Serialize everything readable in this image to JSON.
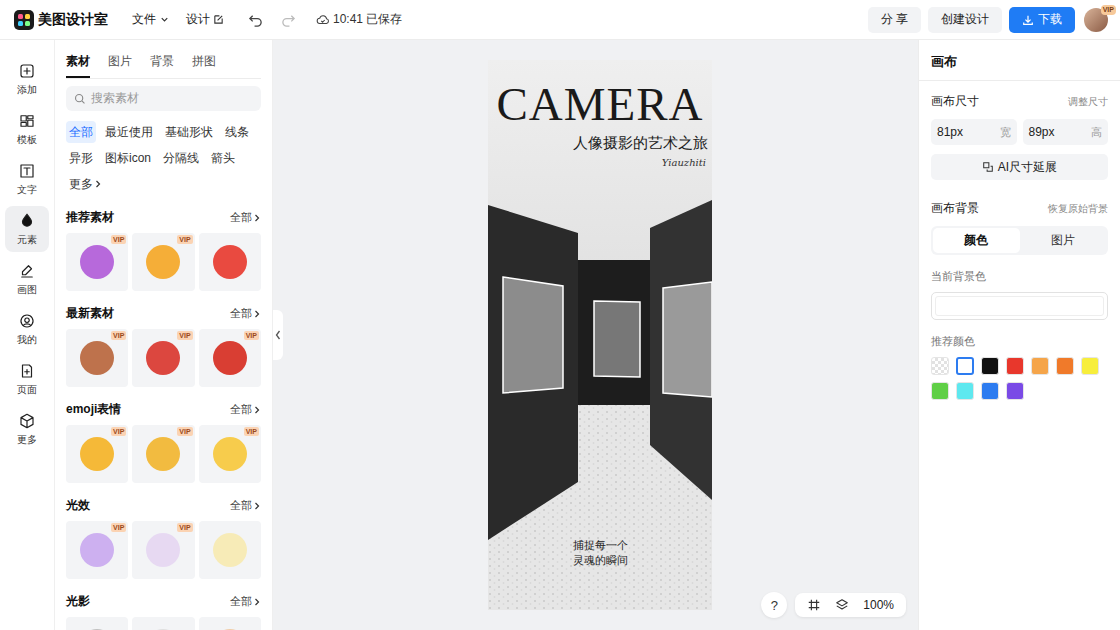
{
  "app": {
    "name": "美图设计室"
  },
  "menus": [
    {
      "label": "文件"
    },
    {
      "label": "设计"
    }
  ],
  "save_status": "10:41 已保存",
  "actions": {
    "share": "分 享",
    "create": "创建设计",
    "download": "下载"
  },
  "avatar": {
    "badge": "VIP"
  },
  "rail": [
    {
      "label": "添加",
      "selected": false
    },
    {
      "label": "模板",
      "selected": false
    },
    {
      "label": "文字",
      "selected": false
    },
    {
      "label": "元素",
      "selected": true
    },
    {
      "label": "画图",
      "selected": false
    },
    {
      "label": "我的",
      "selected": false
    },
    {
      "label": "页面",
      "selected": false
    },
    {
      "label": "更多",
      "selected": false
    }
  ],
  "panel": {
    "tabs": [
      {
        "label": "素材",
        "selected": true
      },
      {
        "label": "图片",
        "selected": false
      },
      {
        "label": "背景",
        "selected": false
      },
      {
        "label": "拼图",
        "selected": false
      }
    ],
    "search": {
      "placeholder": "搜索素材"
    },
    "chips": [
      {
        "label": "全部",
        "selected": true
      },
      {
        "label": "最近使用",
        "selected": false
      },
      {
        "label": "基础形状",
        "selected": false
      },
      {
        "label": "线条",
        "selected": false
      },
      {
        "label": "异形",
        "selected": false
      },
      {
        "label": "图标icon",
        "selected": false
      },
      {
        "label": "分隔线",
        "selected": false
      },
      {
        "label": "箭头",
        "selected": false
      },
      {
        "label": "更多",
        "selected": false
      }
    ],
    "sections": [
      {
        "title": "推荐素材",
        "more": "全部",
        "tiles": [
          {
            "badge": "VIP",
            "color": "#b05ad8"
          },
          {
            "badge": "VIP",
            "color": "#f5a623"
          },
          {
            "badge": "",
            "color": "#e8372c"
          }
        ]
      },
      {
        "title": "最新素材",
        "more": "全部",
        "tiles": [
          {
            "badge": "VIP",
            "color": "#b8643a"
          },
          {
            "badge": "VIP",
            "color": "#d9342b"
          },
          {
            "badge": "VIP",
            "color": "#d62a1e"
          }
        ]
      },
      {
        "title": "emoji表情",
        "more": "全部",
        "tiles": [
          {
            "badge": "VIP",
            "color": "#f5b323"
          },
          {
            "badge": "VIP",
            "color": "#f2b52c"
          },
          {
            "badge": "VIP",
            "color": "#f7c83a"
          }
        ]
      },
      {
        "title": "光效",
        "more": "全部",
        "tiles": [
          {
            "badge": "VIP",
            "color": "#c9a8f0"
          },
          {
            "badge": "VIP",
            "color": "#e6d6f2"
          },
          {
            "badge": "",
            "color": "#f7eab0"
          }
        ]
      },
      {
        "title": "光影",
        "more": "全部",
        "tiles": [
          {
            "badge": "",
            "color": "#bbbbbb"
          },
          {
            "badge": "",
            "color": "#dddddd"
          },
          {
            "badge": "",
            "color": "#f0c9a0"
          }
        ]
      }
    ]
  },
  "poster": {
    "title": "CAMERA",
    "subtitle": "人像摄影的艺术之旅",
    "signature": "Yiauzhiti",
    "caption": [
      "捕捉每一个",
      "灵魂的瞬间"
    ]
  },
  "zoom": {
    "help": "?",
    "level_text": "100%"
  },
  "props": {
    "title": "画布",
    "size": {
      "label": "画布尺寸",
      "action": "调整尺寸",
      "width": {
        "value": "81px",
        "unit": "宽"
      },
      "height": {
        "value": "89px",
        "unit": "高"
      },
      "ai_button": "AI尺寸延展"
    },
    "background": {
      "label": "画布背景",
      "action": "恢复原始背景",
      "modes": [
        {
          "label": "颜色",
          "selected": true
        },
        {
          "label": "图片",
          "selected": false
        }
      ],
      "current_label": "当前背景色",
      "current_color": "#ffffff",
      "recommended_label": "推荐颜色",
      "swatches": [
        {
          "kind": "transparent",
          "color": "#ffffff",
          "selected": false
        },
        {
          "kind": "solid",
          "color": "#ffffff",
          "selected": true
        },
        {
          "kind": "solid",
          "color": "#111111",
          "selected": false
        },
        {
          "kind": "solid",
          "color": "#e8372c",
          "selected": false
        },
        {
          "kind": "solid",
          "color": "#f5a54a",
          "selected": false
        },
        {
          "kind": "solid",
          "color": "#f07a2a",
          "selected": false
        },
        {
          "kind": "solid",
          "color": "#f7ee3c",
          "selected": false
        },
        {
          "kind": "solid",
          "color": "#5fcf46",
          "selected": false
        },
        {
          "kind": "solid",
          "color": "#5ee8ef",
          "selected": false
        },
        {
          "kind": "solid",
          "color": "#2d7cf0",
          "selected": false
        },
        {
          "kind": "solid",
          "color": "#7a4ae6",
          "selected": false
        }
      ]
    }
  }
}
